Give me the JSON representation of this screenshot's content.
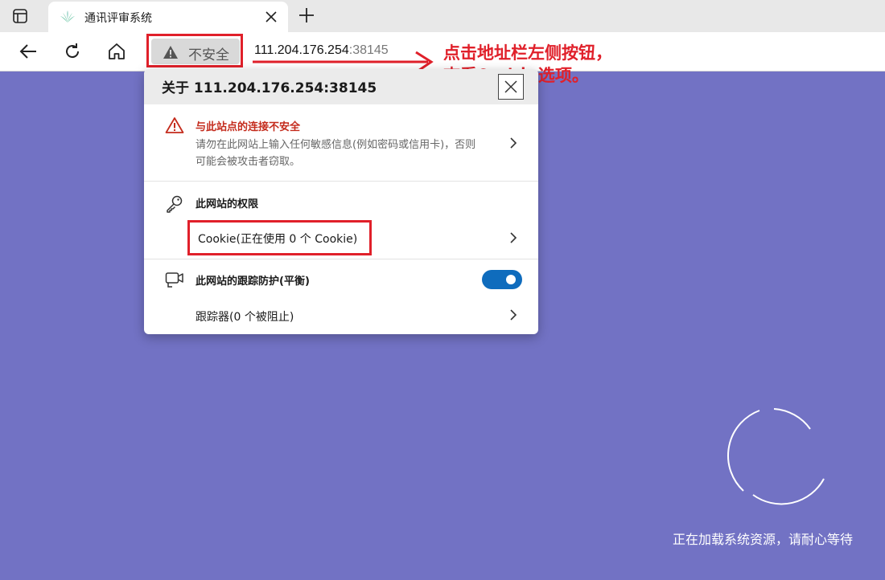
{
  "tab": {
    "title": "通讯评审系统"
  },
  "toolbar": {
    "security_label": "不安全",
    "url_host": "111.204.176.254",
    "url_port": ":38145"
  },
  "annotation": {
    "line1": "点击地址栏左侧按钮，",
    "line2": "查看Cookie选项。"
  },
  "popup": {
    "title": "关于 111.204.176.254:38145",
    "security": {
      "title": "与此站点的连接不安全",
      "description": "请勿在此网站上输入任何敏感信息(例如密码或信用卡)，否则可能会被攻击者窃取。"
    },
    "permissions": {
      "title": "此网站的权限",
      "cookie_label": "Cookie(正在使用 0 个 Cookie)"
    },
    "tracking": {
      "title": "此网站的跟踪防护(平衡)",
      "toggle_on": true,
      "trackers_label": "跟踪器(0 个被阻止)"
    }
  },
  "page": {
    "loading_text": "正在加载系统资源，请耐心等待"
  },
  "colors": {
    "page_background": "#7272c4",
    "annotation_red": "#e0202a",
    "warning_red": "#c42b1c",
    "toggle_blue": "#0f6cbd"
  },
  "icons": [
    "tab-actions-icon",
    "plant-favicon-icon",
    "close-icon",
    "plus-icon",
    "back-arrow-icon",
    "refresh-icon",
    "home-icon",
    "warning-triangle-icon",
    "key-icon",
    "camera-tracking-icon",
    "chevron-right-icon",
    "loading-spinner-icon"
  ]
}
